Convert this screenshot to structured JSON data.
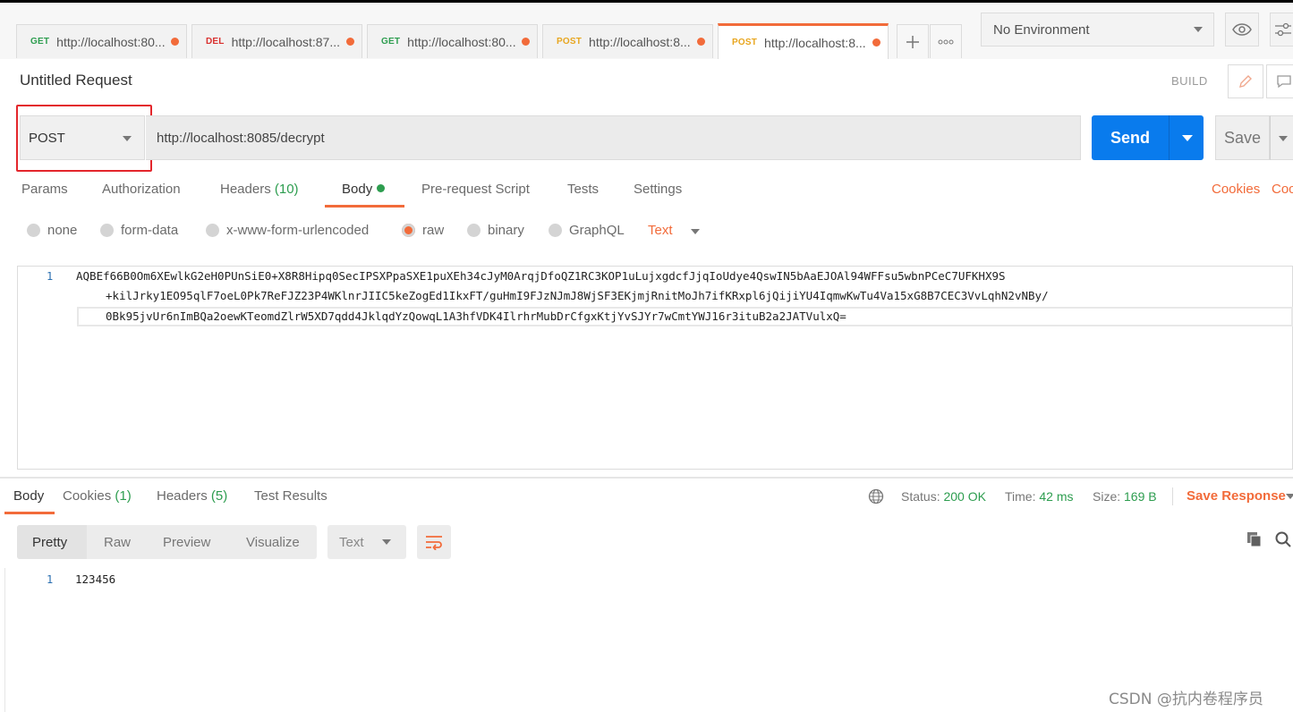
{
  "tabs": [
    {
      "method": "GET",
      "url": "http://localhost:80..."
    },
    {
      "method": "DEL",
      "url": "http://localhost:87..."
    },
    {
      "method": "GET",
      "url": "http://localhost:80..."
    },
    {
      "method": "POST",
      "url": "http://localhost:8..."
    },
    {
      "method": "POST",
      "url": "http://localhost:8..."
    }
  ],
  "environment": {
    "selected": "No Environment"
  },
  "request": {
    "title": "Untitled Request",
    "build_label": "BUILD",
    "method": "POST",
    "url": "http://localhost:8085/decrypt",
    "send_label": "Send",
    "save_label": "Save",
    "tabs": {
      "params": "Params",
      "authorization": "Authorization",
      "headers": "Headers",
      "headers_count": "(10)",
      "body": "Body",
      "prerequest": "Pre-request Script",
      "tests": "Tests",
      "settings": "Settings"
    },
    "cookies_link": "Cookies",
    "code_link": "Coc",
    "body_types": {
      "none": "none",
      "form_data": "form-data",
      "urlencoded": "x-www-form-urlencoded",
      "raw": "raw",
      "binary": "binary",
      "graphql": "GraphQL"
    },
    "raw_format": "Text",
    "body_line_number": "1",
    "body_lines": [
      "AQBEf66B0Om6XEwlkG2eH0PUnSiE0+X8R8Hipq0SecIPSXPpaSXE1puXEh34cJyM0ArqjDfoQZ1RC3KOP1uLujxgdcfJjqIoUdye4QswIN5bAaEJOAl94WFFsu5wbnPCeC7UFKHX9S",
      "+kilJrky1EO95qlF7oeL0Pk7ReFJZ23P4WKlnrJIIC5keZogEd1IkxFT/guHmI9FJzNJmJ8WjSF3EKjmjRnitMoJh7ifKRxpl6jQijiYU4IqmwKwTu4Va15xG8B7CEC3VvLqhN2vNBy/",
      "0Bk95jvUr6nImBQa2oewKTeomdZlrW5XD7qdd4JklqdYzQowqL1A3hfVDK4IlrhrMubDrCfgxKtjYvSJYr7wCmtYWJ16r3ituB2a2JATVulxQ="
    ]
  },
  "response": {
    "tabs": {
      "body": "Body",
      "cookies": "Cookies",
      "cookies_count": "(1)",
      "headers": "Headers",
      "headers_count": "(5)",
      "test_results": "Test Results"
    },
    "status_label": "Status:",
    "status_value": "200 OK",
    "time_label": "Time:",
    "time_value": "42 ms",
    "size_label": "Size:",
    "size_value": "169 B",
    "save_response": "Save Response",
    "views": {
      "pretty": "Pretty",
      "raw": "Raw",
      "preview": "Preview",
      "visualize": "Visualize"
    },
    "format": "Text",
    "line_number": "1",
    "body": "123456"
  },
  "watermark": "CSDN @抗内卷程序员",
  "colors": {
    "accent": "#f26b3a",
    "send": "#097bed",
    "success": "#2d9d4f",
    "highlight": "#e3262c"
  }
}
